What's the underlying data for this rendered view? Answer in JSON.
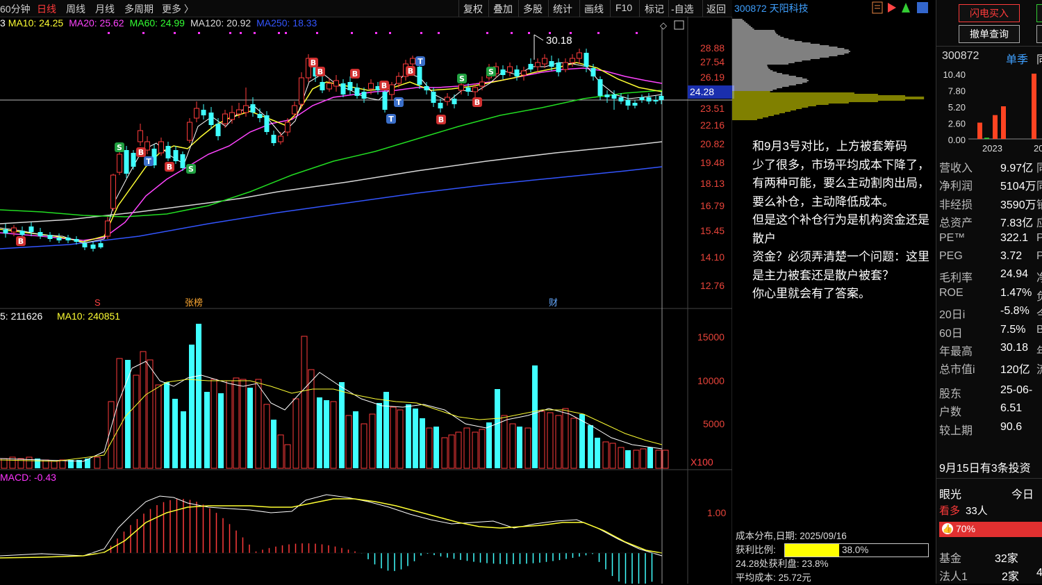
{
  "toolbar": {
    "tabs": [
      "60分钟",
      "日线",
      "周线",
      "月线",
      "多周期",
      "更多 〉"
    ],
    "active_tab": "日线",
    "tools": [
      "复权",
      "叠加",
      "多股",
      "统计",
      "画线",
      "F10",
      "标记",
      "-自选",
      "返回"
    ]
  },
  "ma_legend": {
    "ma5_partial": "3",
    "ma10": "MA10: 24.25",
    "ma20": "MA20: 25.62",
    "ma60": "MA60: 24.99",
    "ma120": "MA120: 20.92",
    "ma250": "MA250: 18.33"
  },
  "colors": {
    "ma10": "#ffff33",
    "ma20": "#ff33ff",
    "ma60": "#33ff33",
    "ma120": "#ffffff",
    "ma250": "#3355ff",
    "up": "#ff3b3b",
    "down": "#40ffff"
  },
  "price_axis": [
    "28.88",
    "27.54",
    "26.19",
    "24.28",
    "23.51",
    "22.16",
    "20.82",
    "19.48",
    "18.13",
    "16.79",
    "15.45",
    "14.10",
    "12.76"
  ],
  "current_price": "24.28",
  "high_label": "30.18",
  "chart_markers": {
    "s_label": "S",
    "zhangbang": "张榜",
    "cai": "财"
  },
  "volume": {
    "legend_vol": "5: 211626",
    "legend_ma10": "MA10: 240851",
    "axis": [
      "15000",
      "10000",
      "5000"
    ],
    "unit": "X100"
  },
  "macd": {
    "legend": "MACD: -0.43",
    "axis": "1.00"
  },
  "stock": {
    "code": "300872",
    "name": "天阳科技"
  },
  "annotation": [
    "和9月3号对比，上方被套筹码",
    "少了很多，市场平均成本下降了，",
    "有两种可能，要么主动割肉出局，",
    "要么补仓，主动降低成本。",
    "但是这个补仓行为是机构资金还是散户",
    "资金？必须弄清楚一个问题：这里",
    "是主力被套还是散户被套？",
    "你心里就会有了答案。"
  ],
  "cost": {
    "date_line": "成本分布,日期: 2025/09/16",
    "profit_label": "获利比例:",
    "profit_value": "38.0%",
    "profit_fraction": 0.38,
    "profit_at_price": "24.28处获利盘: 23.8%",
    "avg_cost": "平均成本: 25.72元"
  },
  "right_panel": {
    "flash_buy": "闪电买入",
    "cancel_query": "撤单查询",
    "code": "300872",
    "quarter": "单季",
    "quarter_next": "同",
    "mini_chart": {
      "y_labels": [
        "10.40",
        "7.80",
        "5.20",
        "2.60",
        "0.00"
      ],
      "x_labels": [
        "2023",
        "20"
      ],
      "bars": [
        2.6,
        0.2,
        3.8,
        5.2,
        10.4
      ]
    },
    "rows": [
      {
        "k": "营收入",
        "v": "9.97亿",
        "s": "同"
      },
      {
        "k": "净利润",
        "v": "5104万",
        "s": "同"
      },
      {
        "k": "非经损",
        "v": "3590万",
        "s": "销"
      },
      {
        "k": "总资产",
        "v": "7.83亿",
        "s": "应"
      },
      {
        "k": "PE™",
        "v": "322.1",
        "s": "P"
      },
      {
        "k": "PEG",
        "v": "3.72",
        "s": "P"
      },
      {
        "k": "毛利率",
        "v": "24.94",
        "s": "净"
      },
      {
        "k": "ROE",
        "v": "1.47%",
        "s": "负"
      },
      {
        "k": "20日i",
        "v": "-5.8%",
        "s": "今"
      },
      {
        "k": "60日",
        "v": "7.5%",
        "s": "B"
      },
      {
        "k": "年最高",
        "v": "30.18",
        "s": "年"
      },
      {
        "k": "总市值i",
        "v": "120亿",
        "s": "流"
      },
      {
        "k": "股东",
        "v": "25-06-",
        "s": ""
      },
      {
        "k": "户数",
        "v": "6.51",
        "s": ""
      },
      {
        "k": "较上期",
        "v": "90.6",
        "s": ""
      }
    ],
    "news": "9月15日有3条投资",
    "yanguang": "眼光",
    "today": "今日",
    "kanduo": "看多",
    "kanduo_count": "33人",
    "pct": "70%",
    "fund": "基金",
    "fund_count": "32家",
    "legal": "法人1",
    "legal_count": "2家",
    "legal_extra": "4"
  }
}
